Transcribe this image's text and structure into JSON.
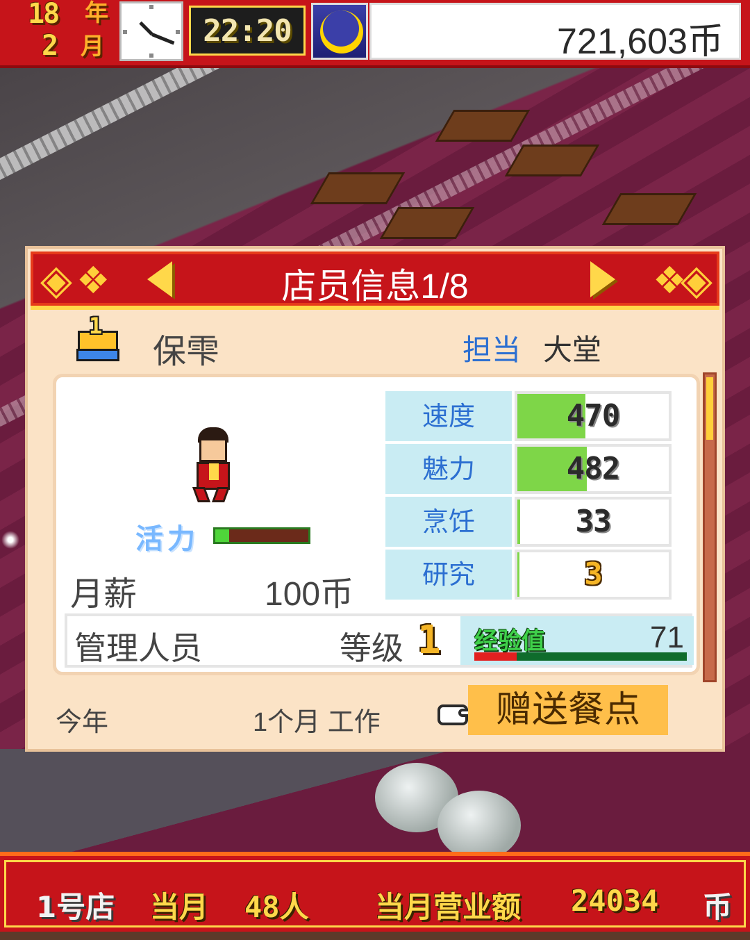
{
  "hud": {
    "year_num": "18",
    "year_unit": "年",
    "month_num": "2",
    "month_unit": "月",
    "time": "22:20",
    "time_of_day_icon": "moon-icon",
    "money": "721,603币"
  },
  "panel": {
    "title": "店员信息1/8",
    "rank": "1",
    "staff_name": "保雫",
    "post_label": "担当",
    "post_value": "大堂",
    "vitality_label": "活力",
    "vitality_level": 0.15,
    "salary_label": "月薪",
    "salary_value": "100币",
    "stats": [
      {
        "label": "速度",
        "value": "470",
        "fill": 0.45
      },
      {
        "label": "魅力",
        "value": "482",
        "fill": 0.46
      },
      {
        "label": "烹饪",
        "value": "33",
        "fill": 0.02
      },
      {
        "label": "研究",
        "value": "3",
        "fill": 0.0
      }
    ],
    "management_label": "管理人员",
    "grade_label": "等级",
    "grade_value": "1",
    "exp_label": "经验值",
    "exp_value": "71",
    "exp_progress": 0.2,
    "this_year_label": "今年",
    "work_months": "1个月 工作",
    "gift_button": "赠送餐点"
  },
  "bottom_bar": {
    "shop": "1号店",
    "month_label": "当月",
    "customers": "48人",
    "revenue_label": "当月营业额",
    "revenue": "24034",
    "revenue_unit": "币"
  },
  "colors": {
    "header_red": "#c6141a",
    "gold": "#ffd84a",
    "panel_bg": "#fbe3c6",
    "stat_label_bg": "#c9ecf3",
    "stat_fill_green": "#7ed648",
    "button_orange": "#ffbf4a"
  }
}
